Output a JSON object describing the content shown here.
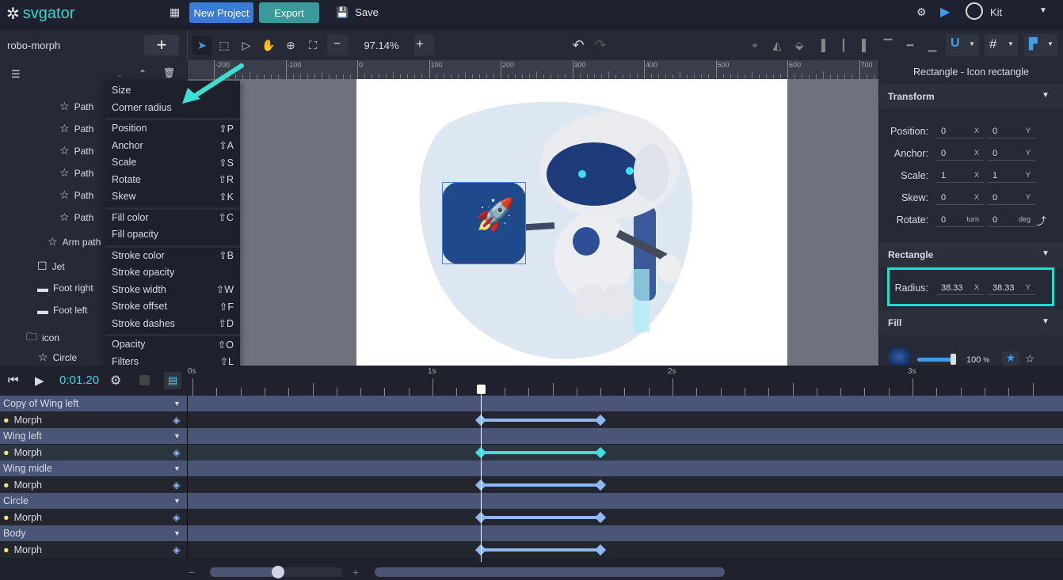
{
  "app": {
    "logo": "svgator",
    "new_project": "New Project",
    "export": "Export",
    "save": "Save",
    "user": "Kit"
  },
  "project": {
    "name": "robo-morph"
  },
  "toolbar": {
    "zoom": "97.14%"
  },
  "ruler": {
    "labels": [
      "-200",
      "-100",
      "0",
      "100",
      "200",
      "300",
      "400",
      "500",
      "600",
      "700"
    ]
  },
  "layers": [
    {
      "label": "Path",
      "icon": "star-icon"
    },
    {
      "label": "Path",
      "icon": "star-icon"
    },
    {
      "label": "Path",
      "icon": "star-icon"
    },
    {
      "label": "Path",
      "icon": "star-icon"
    },
    {
      "label": "Path",
      "icon": "star-icon"
    },
    {
      "label": "Path",
      "icon": "star-icon"
    },
    {
      "label": "Arm path",
      "icon": "star-icon"
    },
    {
      "label": "Jet",
      "icon": "square-icon"
    },
    {
      "label": "Foot right",
      "icon": "folder-icon"
    },
    {
      "label": "Foot left",
      "icon": "folder-icon"
    },
    {
      "label": "icon",
      "icon": "folder-open-icon"
    },
    {
      "label": "Circle",
      "icon": "star-icon"
    }
  ],
  "menu": {
    "groups": [
      [
        {
          "label": "Size",
          "shortcut": ""
        },
        {
          "label": "Corner radius",
          "shortcut": ""
        }
      ],
      [
        {
          "label": "Position",
          "shortcut": "⇧P"
        },
        {
          "label": "Anchor",
          "shortcut": "⇧A"
        },
        {
          "label": "Scale",
          "shortcut": "⇧S"
        },
        {
          "label": "Rotate",
          "shortcut": "⇧R"
        },
        {
          "label": "Skew",
          "shortcut": "⇧K"
        }
      ],
      [
        {
          "label": "Fill color",
          "shortcut": "⇧C"
        },
        {
          "label": "Fill opacity",
          "shortcut": ""
        }
      ],
      [
        {
          "label": "Stroke color",
          "shortcut": "⇧B"
        },
        {
          "label": "Stroke opacity",
          "shortcut": ""
        },
        {
          "label": "Stroke width",
          "shortcut": "⇧W"
        },
        {
          "label": "Stroke offset",
          "shortcut": "⇧F"
        },
        {
          "label": "Stroke dashes",
          "shortcut": "⇧D"
        }
      ],
      [
        {
          "label": "Opacity",
          "shortcut": "⇧O"
        },
        {
          "label": "Filters",
          "shortcut": "⇧L"
        }
      ]
    ]
  },
  "panel": {
    "title": "Rectangle - Icon rectangle",
    "transform": "Transform",
    "rows": [
      {
        "label": "Position:",
        "a": "0",
        "au": "X",
        "b": "0",
        "bu": "Y"
      },
      {
        "label": "Anchor:",
        "a": "0",
        "au": "X",
        "b": "0",
        "bu": "Y"
      },
      {
        "label": "Scale:",
        "a": "1",
        "au": "X",
        "b": "1",
        "bu": "Y"
      },
      {
        "label": "Skew:",
        "a": "0",
        "au": "X",
        "b": "0",
        "bu": "Y"
      },
      {
        "label": "Rotate:",
        "a": "0",
        "au": "turn",
        "b": "0",
        "bu": "deg"
      }
    ],
    "rectangle": "Rectangle",
    "radius": {
      "label": "Radius:",
      "x": "38.33",
      "xu": "X",
      "y": "38.33",
      "yu": "Y"
    },
    "fill": "Fill",
    "fill_opacity": "100",
    "fill_unit": "%",
    "fill_opacity_value": 100
  },
  "timeline": {
    "time": "0:01.20",
    "seconds": [
      "0s",
      "1s",
      "2s",
      "3s"
    ],
    "playhead_s": 1.2,
    "rows": [
      {
        "group": "Copy of Wing left",
        "prop": "Morph",
        "kf": [
          1.2,
          1.7
        ],
        "active": false
      },
      {
        "group": "Wing left",
        "prop": "Morph",
        "kf": [
          1.2,
          1.7
        ],
        "active": true
      },
      {
        "group": "Wing midle",
        "prop": "Morph",
        "kf": [
          1.2,
          1.7
        ],
        "active": false
      },
      {
        "group": "Circle",
        "prop": "Morph",
        "kf": [
          1.2,
          1.7
        ],
        "active": false
      },
      {
        "group": "Body",
        "prop": "Morph",
        "kf": [
          1.2,
          1.7
        ],
        "active": false
      }
    ],
    "zoom_minus": "−",
    "zoom_plus": "+"
  },
  "colors": {
    "accent": "#3dd6c6",
    "brand_blue": "#3a7bd5",
    "teal": "#3a9a9a",
    "kf": "#8fb8f0"
  }
}
